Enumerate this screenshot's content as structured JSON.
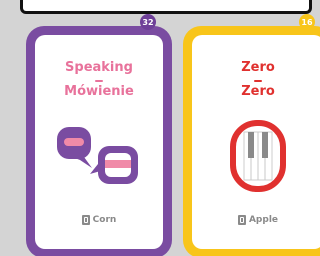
{
  "cards": [
    {
      "badge": "32",
      "word": "Speaking",
      "translation": "Mówienie",
      "owner": "Corn",
      "icon": "speech-bubbles-icon",
      "accent_color": "#7a4ca1",
      "text_color": "#e8729b"
    },
    {
      "badge": "16",
      "word": "Zero",
      "translation": "Zero",
      "owner": "Apple",
      "icon": "piano-keys-icon",
      "accent_color": "#f8c51a",
      "text_color": "#e0312f"
    }
  ]
}
